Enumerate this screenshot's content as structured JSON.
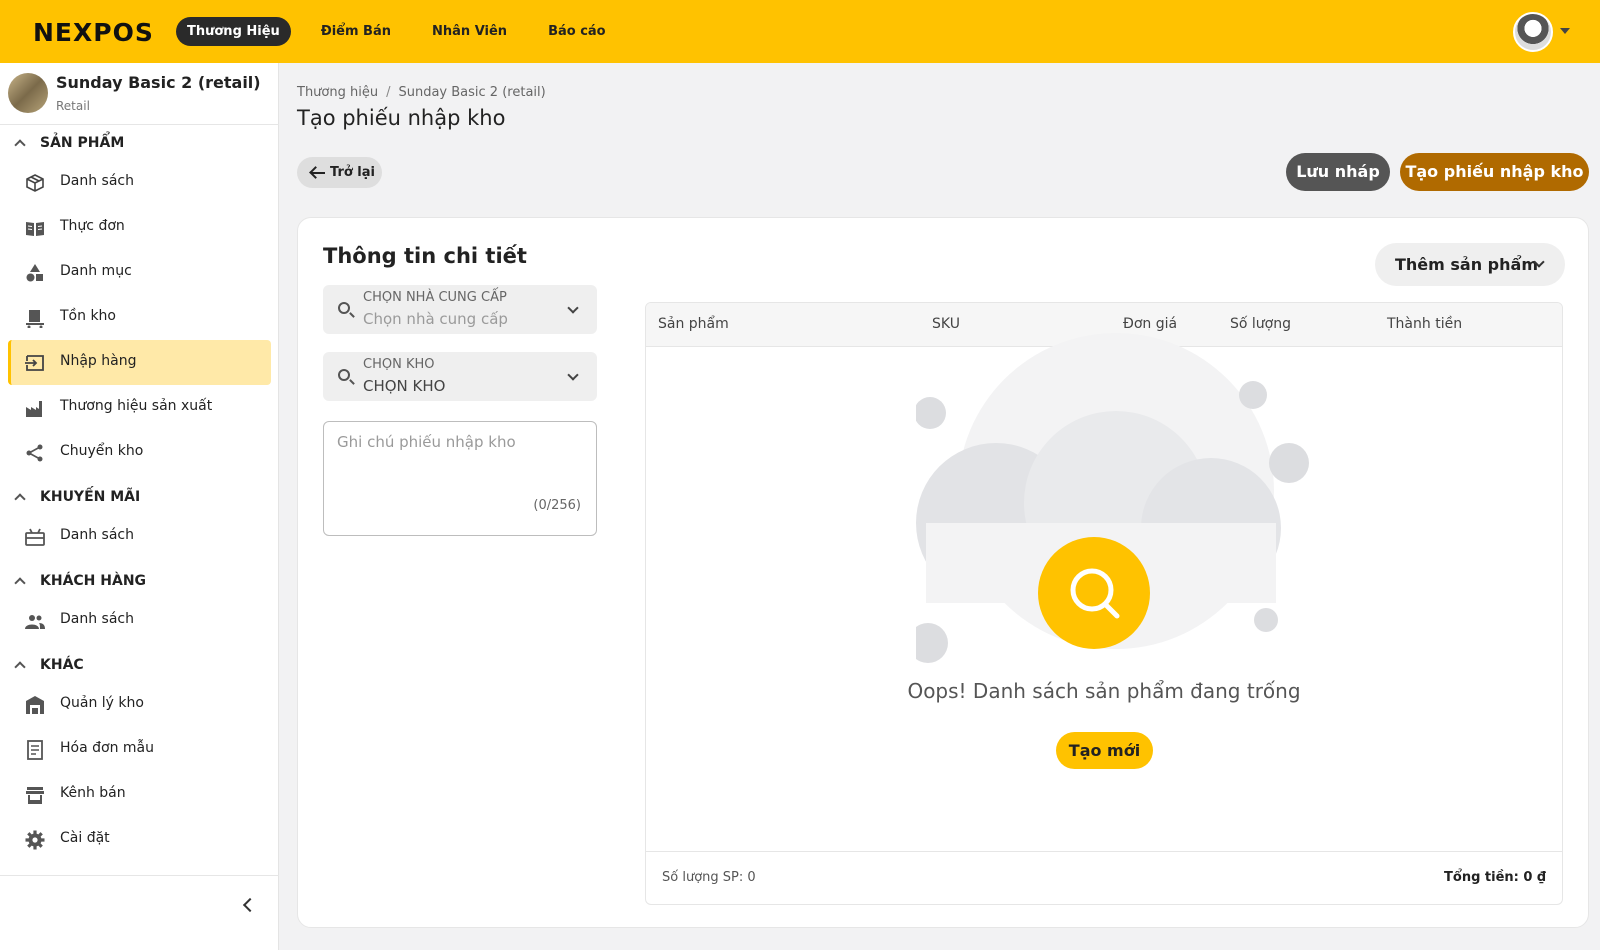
{
  "header": {
    "logo": "NEXPOS",
    "nav": [
      "Thương Hiệu",
      "Điểm Bán",
      "Nhân Viên",
      "Báo cáo"
    ]
  },
  "store": {
    "name": "Sunday Basic 2 (retail)",
    "type": "Retail"
  },
  "sidebar": {
    "groups": [
      {
        "title": "SẢN PHẨM",
        "items": [
          "Danh sách",
          "Thực đơn",
          "Danh mục",
          "Tồn kho",
          "Nhập hàng",
          "Thương hiệu sản xuất",
          "Chuyển kho"
        ]
      },
      {
        "title": "KHUYẾN MÃI",
        "items": [
          "Danh sách"
        ]
      },
      {
        "title": "KHÁCH HÀNG",
        "items": [
          "Danh sách"
        ]
      },
      {
        "title": "KHÁC",
        "items": [
          "Quản lý kho",
          "Hóa đơn mẫu",
          "Kênh bán",
          "Cài đặt"
        ]
      }
    ]
  },
  "breadcrumb": {
    "root": "Thương hiệu",
    "current": "Sunday Basic 2 (retail)"
  },
  "page": {
    "title": "Tạo phiếu nhập kho",
    "back": "Trở lại",
    "save_draft": "Lưu nháp",
    "create": "Tạo phiếu nhập kho"
  },
  "detail": {
    "title": "Thông tin chi tiết",
    "add_product": "Thêm sản phẩm",
    "supplier": {
      "label": "CHỌN NHÀ CUNG CẤP",
      "placeholder": "Chọn nhà cung cấp"
    },
    "warehouse": {
      "label": "CHỌN KHO",
      "value": "CHỌN KHO"
    },
    "note": {
      "placeholder": "Ghi chú phiếu nhập kho",
      "count": "(0/256)"
    }
  },
  "table": {
    "columns": [
      "Sản phẩm",
      "SKU",
      "Đơn giá",
      "Số lượng",
      "Thành tiền"
    ],
    "empty_text": "Oops! Danh sách sản phẩm đang trống",
    "new_button": "Tạo mới",
    "qty_summary": "Số lượng SP: 0",
    "total_summary": "Tổng tiền: 0 ₫"
  },
  "colors": {
    "accent": "#ffc200",
    "primary": "#b06a00",
    "active_bg": "#ffe9a8"
  },
  "icons": {
    "sidebar": [
      "box-icon",
      "menu-book-icon",
      "category-icon",
      "inventory-icon",
      "import-icon",
      "factory-icon",
      "share-icon",
      "promotion-icon",
      "customers-icon",
      "warehouse-icon",
      "invoice-icon",
      "store-icon",
      "settings-icon"
    ]
  }
}
